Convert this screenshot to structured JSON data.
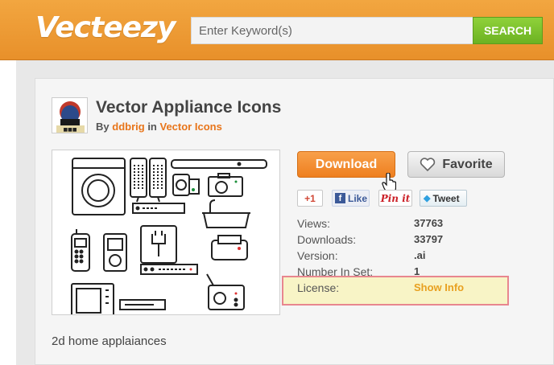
{
  "header": {
    "logo": "Vecteezy",
    "search_placeholder": "Enter Keyword(s)",
    "search_button": "SEARCH"
  },
  "item": {
    "title": "Vector Appliance Icons",
    "by_label": "By",
    "author": "ddbrig",
    "in_label": "in",
    "category": "Vector Icons",
    "description": "2d home applaiances"
  },
  "actions": {
    "download": "Download",
    "favorite": "Favorite"
  },
  "share": {
    "gplus": "+1",
    "facebook": "Like",
    "pinterest": "Pin it",
    "twitter": "Tweet"
  },
  "meta": [
    {
      "label": "Views:",
      "value": "37763"
    },
    {
      "label": "Downloads:",
      "value": "33797"
    },
    {
      "label": "Version:",
      "value": ".ai"
    },
    {
      "label": "Number In Set:",
      "value": "1"
    },
    {
      "label": "License:",
      "value": "Show Info"
    }
  ],
  "colors": {
    "brand_orange": "#ee8a2a",
    "search_green": "#7cc22e",
    "link_orange": "#e8751a",
    "license_highlight": "#f8f4c6",
    "license_border": "#e8868f"
  }
}
